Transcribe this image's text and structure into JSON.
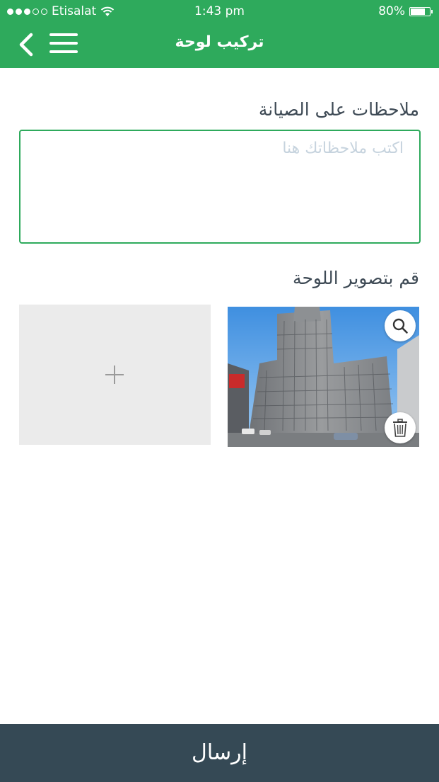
{
  "status_bar": {
    "carrier": "Etisalat",
    "time": "1:43 pm",
    "battery": "80%",
    "battery_level": 0.8
  },
  "header": {
    "title": "تركيب لوحة",
    "menu_icon": "hamburger-menu-icon",
    "back_icon": "chevron-left-icon",
    "bg_color": "#2eaa5c"
  },
  "notes": {
    "label": "ملاحظات على الصيانة",
    "placeholder": "اكتب ملاحظاتك هنا",
    "value": ""
  },
  "photos": {
    "label": "قم بتصوير اللوحة",
    "add_icon": "plus-icon",
    "zoom_icon": "search-icon",
    "delete_icon": "trash-icon"
  },
  "submit": {
    "label": "إرسال",
    "bg_color": "#354955"
  }
}
